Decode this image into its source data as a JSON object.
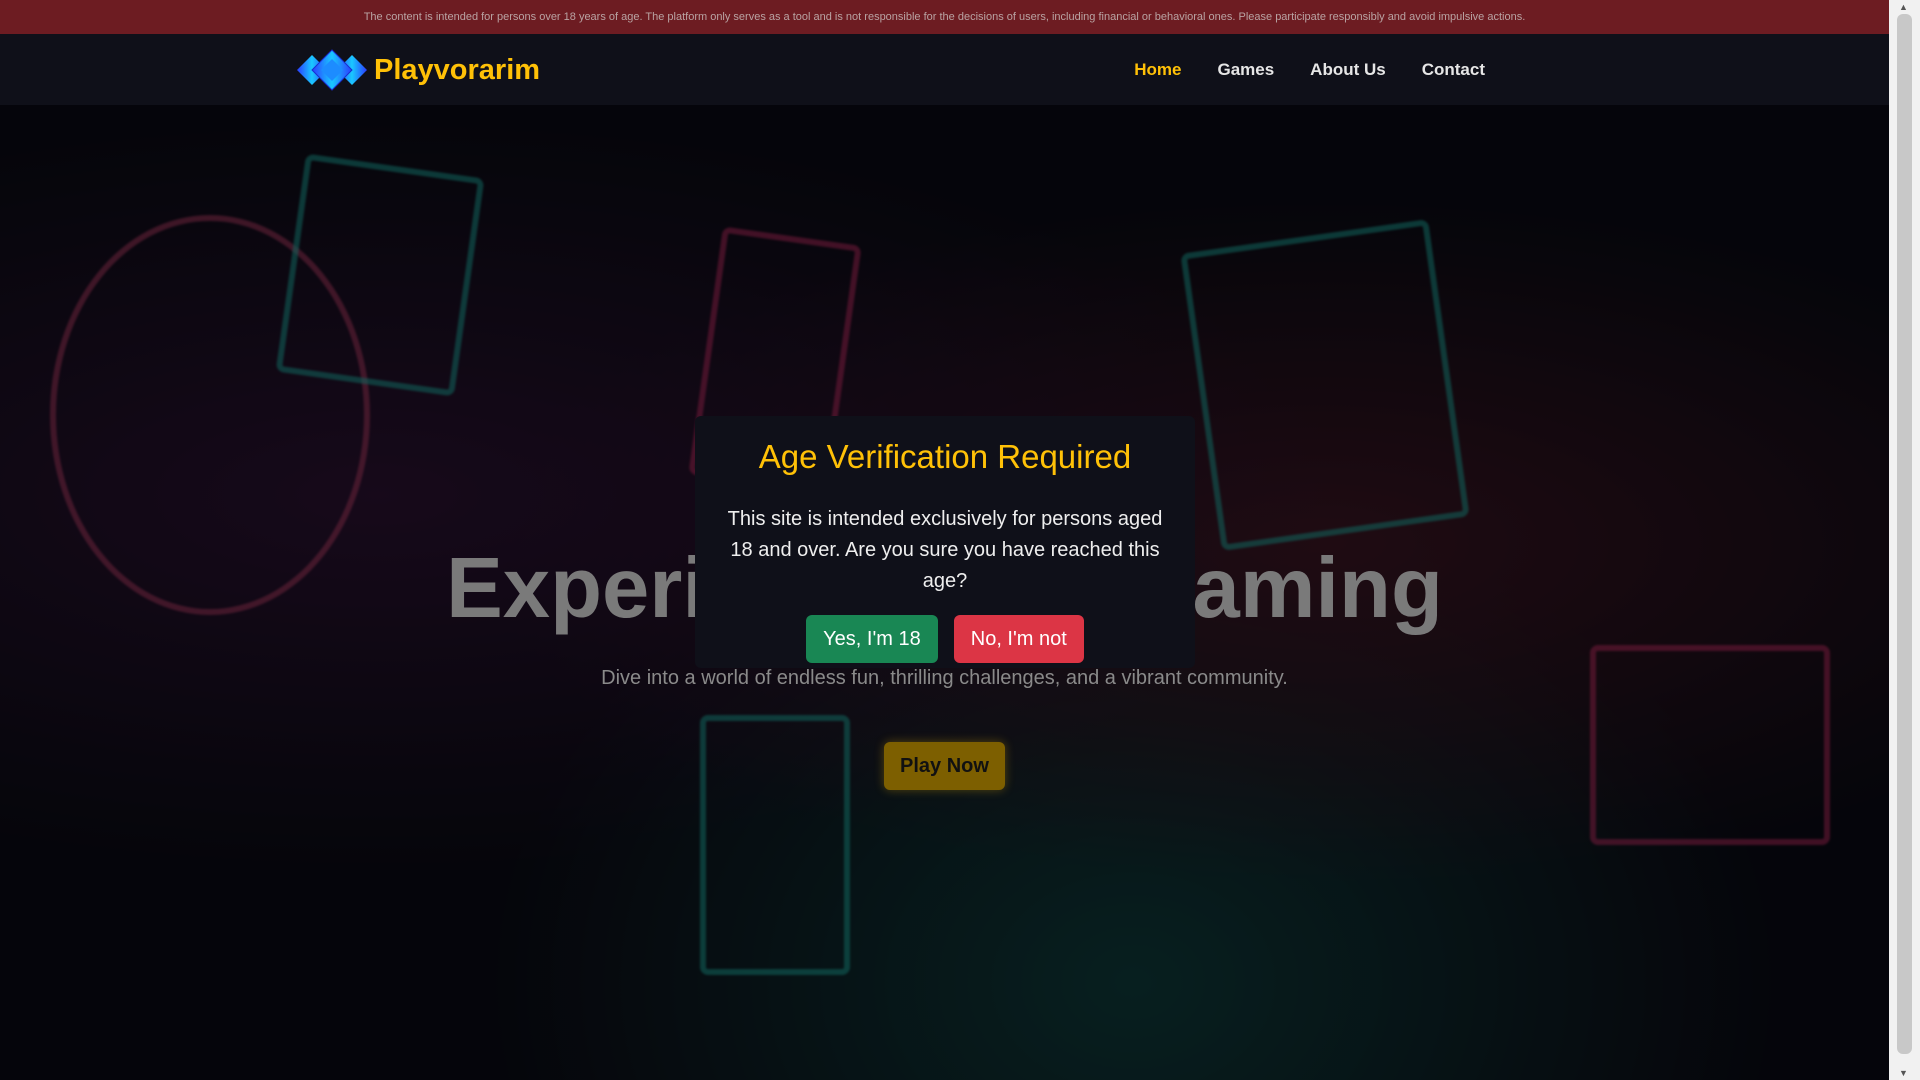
{
  "disclaimer": "The content is intended for persons over 18 years of age. The platform only serves as a tool and is not responsible for the decisions of users, including financial or behavioral ones. Please participate responsibly and avoid impulsive actions.",
  "brand": "Playvorarim",
  "nav": [
    {
      "label": "Home"
    },
    {
      "label": "Games"
    },
    {
      "label": "About Us"
    },
    {
      "label": "Contact"
    }
  ],
  "hero": {
    "title": "Experience Epic Gaming",
    "subtitle": "Dive into a world of endless fun, thrilling challenges, and a vibrant community.",
    "cta": "Play Now"
  },
  "modal": {
    "title": "Age Verification Required",
    "body": "This site is intended exclusively for persons aged 18 and over. Are you sure you have reached this age?",
    "yes": "Yes, I'm 18",
    "no": "No, I'm not"
  },
  "colors": {
    "accent": "#ffc107",
    "yes": "#198754",
    "no": "#dc3545",
    "topbar": "#6d1c22"
  }
}
